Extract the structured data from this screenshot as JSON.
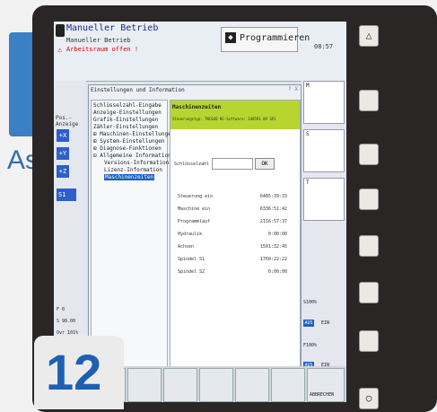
{
  "header": {
    "mode_title": "Manueller Betrieb",
    "mode_subtitle": "Manueller Betrieb",
    "alarm_text": "Arbeitsraum offen !",
    "program_button": "Programmieren",
    "clock": "08:57"
  },
  "left": {
    "pos_label": "Pos.-Anzeige",
    "axes": [
      "+X",
      "+Y",
      "+Z"
    ],
    "spindle": "S1",
    "status": [
      "F 0",
      "S 98.00",
      "Ovr 101%"
    ]
  },
  "dialog": {
    "title": "Einstellungen und Information",
    "menu": [
      "Schlüsselzahl-Eingabe",
      "Anzeige-Einstellungen",
      "Grafik-Einstellungen",
      "Zähler-Einstellungen",
      "Maschinen-Einstellungen",
      "System-Einstellungen",
      "Diagnose-Funktionen",
      "Allgemeine Information",
      "Versions-Information",
      "Lizenz-Information",
      "Maschinenzeiten"
    ],
    "selected_index": 10,
    "content": {
      "title": "Maschinenzeiten",
      "subtitle": "Steuerungstyp: TNC640   NC-Software: 340591 09 SP1",
      "password_label": "Schlüsselzahl",
      "ok_label": "OK",
      "rows": [
        {
          "label": "Steuerung ein",
          "value": "6485:39:33"
        },
        {
          "label": "Maschine ein",
          "value": "6336:51:42"
        },
        {
          "label": "Programmlauf",
          "value": "2116:57:37"
        },
        {
          "label": "Hydraulik",
          "value": "0:00:00"
        },
        {
          "label": "Achsen",
          "value": "1501:32:45"
        },
        {
          "label": "Spindel S1",
          "value": "1760:22:22"
        },
        {
          "label": "Spindel S2",
          "value": "0:00:00"
        }
      ]
    }
  },
  "right": {
    "labels": [
      "M",
      "S",
      "T"
    ],
    "ovr1": "S100%",
    "ovr2": "F100%",
    "aus": "AUS",
    "ein": "EIN"
  },
  "softkeys": {
    "last": "ABBRECHEN"
  },
  "badge": {
    "number": "12"
  },
  "background": {
    "text": "As"
  }
}
